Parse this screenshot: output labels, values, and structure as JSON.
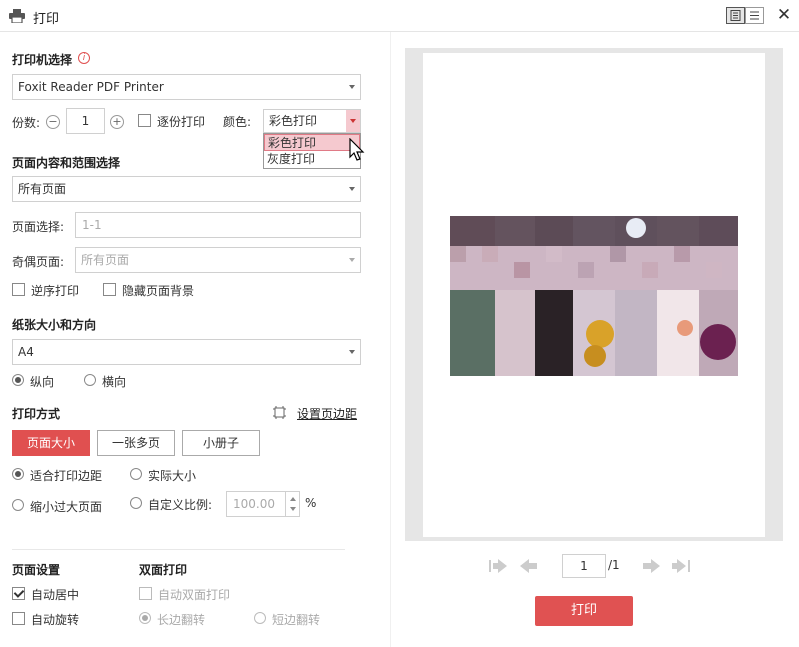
{
  "window": {
    "title": "打印",
    "close": "✕"
  },
  "printer": {
    "section_title": "打印机选择",
    "info_icon": "i",
    "selected": "Foxit Reader PDF Printer",
    "copies_label": "份数:",
    "copies_value": "1",
    "minus": "−",
    "plus": "+",
    "collate_label": "逐份打印",
    "color_label": "颜色:",
    "color_selected": "彩色打印",
    "color_options": [
      "彩色打印",
      "灰度打印"
    ]
  },
  "range": {
    "section_title": "页面内容和范围选择",
    "selected": "所有页面",
    "page_select_label": "页面选择:",
    "page_select_placeholder": "1-1",
    "odd_even_label": "奇偶页面:",
    "odd_even_value": "所有页面",
    "reverse_label": "逆序打印",
    "hide_bg_label": "隐藏页面背景"
  },
  "paper": {
    "section_title": "纸张大小和方向",
    "size": "A4",
    "portrait_label": "纵向",
    "landscape_label": "横向"
  },
  "mode": {
    "section_title": "打印方式",
    "margin_link": "设置页边距",
    "buttons": [
      "页面大小",
      "一张多页",
      "小册子"
    ],
    "fit_margin_label": "适合打印边距",
    "actual_size_label": "实际大小",
    "shrink_label": "缩小过大页面",
    "custom_scale_label": "自定义比例:",
    "scale_value": "100.00",
    "percent": "%"
  },
  "page_settings": {
    "section_title": "页面设置",
    "auto_center_label": "自动居中",
    "auto_rotate_label": "自动旋转"
  },
  "duplex": {
    "section_title": "双面打印",
    "auto_duplex_label": "自动双面打印",
    "long_edge_label": "长边翻转",
    "short_edge_label": "短边翻转"
  },
  "preview": {
    "page_current": "1",
    "page_total": "/1"
  },
  "actions": {
    "print_label": "打印"
  },
  "colors": {
    "accent": "#e05252",
    "frame": "#e6e6e6"
  }
}
